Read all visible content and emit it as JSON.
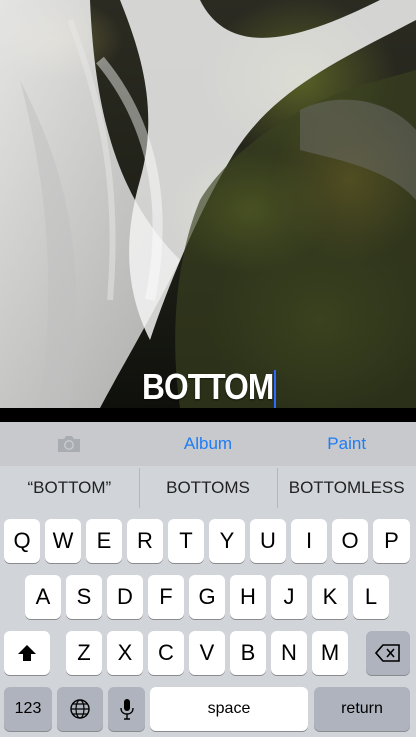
{
  "caption": {
    "text": "BOTTOM"
  },
  "toolbar": {
    "camera_icon": "camera-icon",
    "album_label": "Album",
    "paint_label": "Paint"
  },
  "suggestions": [
    "“BOTTOM”",
    "BOTTOMS",
    "BOTTOMLESS"
  ],
  "keyboard": {
    "row1": [
      "Q",
      "W",
      "E",
      "R",
      "T",
      "Y",
      "U",
      "I",
      "O",
      "P"
    ],
    "row2": [
      "A",
      "S",
      "D",
      "F",
      "G",
      "H",
      "J",
      "K",
      "L"
    ],
    "row3": [
      "Z",
      "X",
      "C",
      "V",
      "B",
      "N",
      "M"
    ],
    "numbers_label": "123",
    "space_label": "space",
    "return_label": "return",
    "shift_icon": "shift-icon",
    "backspace_icon": "backspace-icon",
    "globe_icon": "globe-icon",
    "mic_icon": "microphone-icon"
  },
  "colors": {
    "accent": "#1f7cf5",
    "cursor": "#2d6bff",
    "keyboard_bg": "#d1d4d9"
  }
}
